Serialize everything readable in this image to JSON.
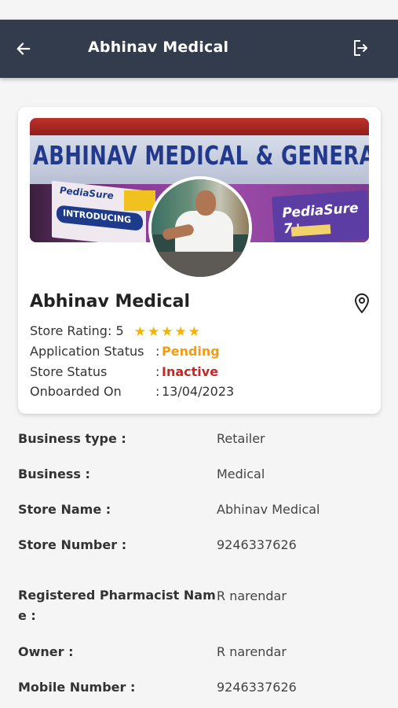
{
  "header": {
    "title": "Abhinav Medical",
    "back_icon": "arrow-left-icon",
    "logout_icon": "logout-icon",
    "background": "#333c4d"
  },
  "banner": {
    "sign_text": "ABHINAV MEDICAL & GENERAL STO",
    "poster_brand": "PediaSure",
    "poster_band": "INTRODUCING",
    "box_text": "PediaSure 7+"
  },
  "store": {
    "name": "Abhinav Medical",
    "location_icon": "map-pin-icon",
    "rating_label": "Store Rating: 5",
    "rating_value": 5,
    "application_status_label": "Application Status",
    "application_status": "Pending",
    "store_status_label": "Store Status",
    "store_status": "Inactive",
    "onboarded_label": "Onboarded On",
    "onboarded_on": "13/04/2023",
    "colon": ":"
  },
  "details": [
    {
      "label": "Business type :",
      "value": "Retailer"
    },
    {
      "label": "Business :",
      "value": "Medical"
    },
    {
      "label": "Store Name :",
      "value": "Abhinav Medical"
    },
    {
      "label": "Store Number :",
      "value": "9246337626"
    },
    {
      "label": "Registered Pharmacist Name :",
      "value": "R narendar"
    },
    {
      "label": "Owner :",
      "value": "R narendar"
    },
    {
      "label": "Mobile Number :",
      "value": "9246337626"
    }
  ],
  "colors": {
    "pending": "#f39c12",
    "inactive": "#c62828",
    "star": "#f5b301"
  }
}
